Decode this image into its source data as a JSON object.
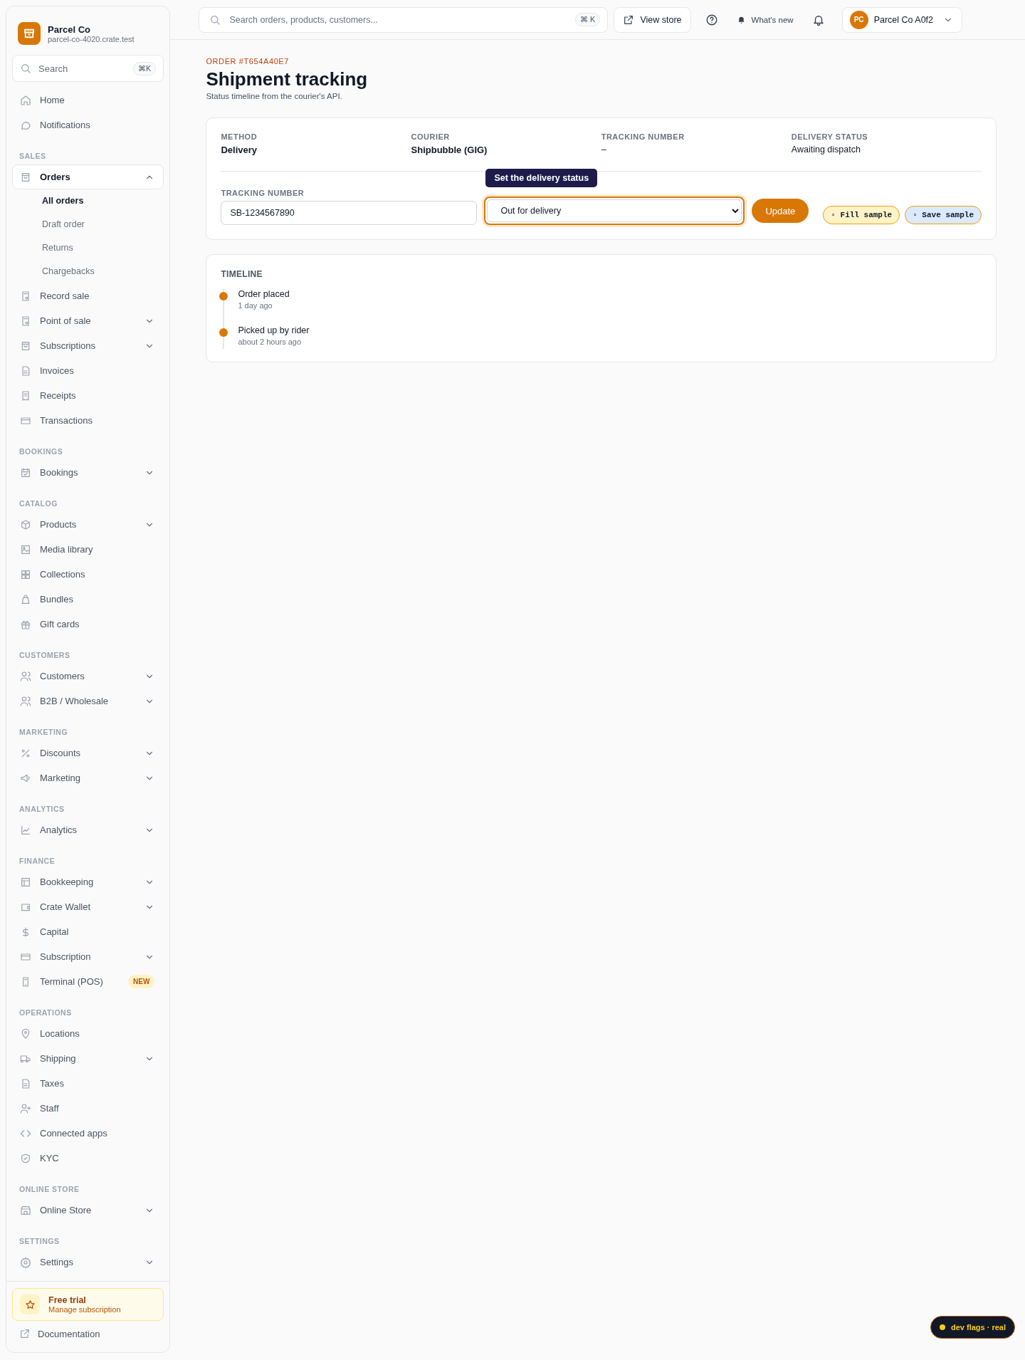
{
  "sidebar": {
    "brand": {
      "name": "Parcel Co",
      "domain": "parcel-co-4020.crate.test"
    },
    "search": {
      "placeholder": "Search",
      "shortcut": "⌘K"
    },
    "sections": [
      {
        "items": [
          {
            "label": "Home",
            "selected": false
          },
          {
            "label": "Notifications",
            "selected": false
          }
        ]
      },
      {
        "title": "SALES",
        "items": [
          {
            "label": "Orders",
            "expanded": true,
            "selected": true,
            "children": [
              {
                "label": "All orders",
                "selected": true
              },
              {
                "label": "Draft order",
                "selected": false
              },
              {
                "label": "Returns",
                "selected": false
              },
              {
                "label": "Chargebacks",
                "selected": false
              }
            ]
          },
          {
            "label": "Record sale",
            "selected": false
          },
          {
            "label": "Point of sale",
            "expanded": false,
            "selected": false
          },
          {
            "label": "Subscriptions",
            "expanded": false,
            "selected": false
          },
          {
            "label": "Invoices",
            "selected": false
          },
          {
            "label": "Receipts",
            "selected": false
          },
          {
            "label": "Transactions",
            "selected": false
          }
        ]
      },
      {
        "title": "BOOKINGS",
        "items": [
          {
            "label": "Bookings",
            "expanded": false,
            "selected": false
          }
        ]
      },
      {
        "title": "CATALOG",
        "items": [
          {
            "label": "Products",
            "expanded": false,
            "selected": false
          },
          {
            "label": "Media library",
            "selected": false
          },
          {
            "label": "Collections",
            "selected": false
          },
          {
            "label": "Bundles",
            "selected": false
          },
          {
            "label": "Gift cards",
            "selected": false
          }
        ]
      },
      {
        "title": "CUSTOMERS",
        "items": [
          {
            "label": "Customers",
            "expanded": false,
            "selected": false
          },
          {
            "label": "B2B / Wholesale",
            "expanded": false,
            "selected": false
          }
        ]
      },
      {
        "title": "MARKETING",
        "items": [
          {
            "label": "Discounts",
            "expanded": false,
            "selected": false
          },
          {
            "label": "Marketing",
            "expanded": false,
            "selected": false
          }
        ]
      },
      {
        "title": "ANALYTICS",
        "items": [
          {
            "label": "Analytics",
            "expanded": false,
            "selected": false
          }
        ]
      },
      {
        "title": "FINANCE",
        "items": [
          {
            "label": "Bookkeeping",
            "expanded": false,
            "selected": false
          },
          {
            "label": "Crate Wallet",
            "expanded": false,
            "selected": false
          },
          {
            "label": "Capital",
            "selected": false
          },
          {
            "label": "Subscription",
            "expanded": false,
            "selected": false
          },
          {
            "label": "Terminal (POS)",
            "selected": false,
            "badge": "NEW"
          }
        ]
      },
      {
        "title": "OPERATIONS",
        "items": [
          {
            "label": "Locations",
            "selected": false
          },
          {
            "label": "Shipping",
            "expanded": false,
            "selected": false
          },
          {
            "label": "Taxes",
            "selected": false
          },
          {
            "label": "Staff",
            "selected": false
          },
          {
            "label": "Connected apps",
            "selected": false
          },
          {
            "label": "KYC",
            "selected": false
          }
        ]
      },
      {
        "title": "ONLINE STORE",
        "items": [
          {
            "label": "Online Store",
            "expanded": false,
            "selected": false
          }
        ]
      },
      {
        "title": "SETTINGS",
        "items": [
          {
            "label": "Settings",
            "expanded": false,
            "selected": false
          }
        ]
      }
    ],
    "trial": {
      "title": "Free trial",
      "subtitle": "Manage subscription"
    },
    "documentation": "Documentation"
  },
  "header": {
    "search": {
      "placeholder": "Search orders, products, customers...",
      "shortcut": "⌘ K"
    },
    "view_store": "View store",
    "whats_new": "What's new",
    "account": {
      "initials": "PC",
      "name": "Parcel Co A0f2"
    }
  },
  "page": {
    "eyebrow": "ORDER #T654A40E7",
    "title": "Shipment tracking",
    "subtitle": "Status timeline from the courier's API."
  },
  "summary": [
    {
      "label": "METHOD",
      "value": "Delivery",
      "emphasis": true
    },
    {
      "label": "COURIER",
      "value": "Shipbubble (GIG)",
      "emphasis": true
    },
    {
      "label": "TRACKING NUMBER",
      "value": "–",
      "emphasis": false
    },
    {
      "label": "DELIVERY STATUS",
      "value": "Awaiting dispatch",
      "emphasis": false
    }
  ],
  "form": {
    "tracking": {
      "label": "TRACKING NUMBER",
      "value": "SB-1234567890"
    },
    "status": {
      "value": "Out for delivery",
      "focused": true,
      "tooltip": "Set the delivery status"
    },
    "update": "Update",
    "samples": [
      {
        "label": "▫ Fill sample",
        "color": "#fef3c7"
      },
      {
        "label": "▫ Save sample",
        "color": "#dbeafe"
      }
    ]
  },
  "timeline": {
    "title": "TIMELINE",
    "events": [
      {
        "title": "Order placed",
        "time": "1 day ago"
      },
      {
        "title": "Picked up by rider",
        "time": "about 2 hours ago"
      }
    ]
  },
  "dev_flags": "dev flags · real"
}
